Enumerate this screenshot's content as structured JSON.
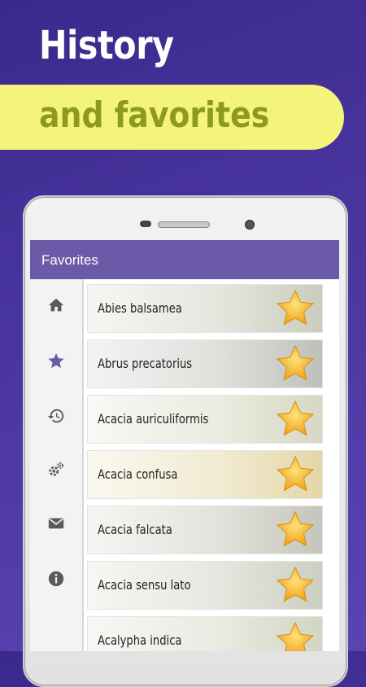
{
  "promo": {
    "title": "History",
    "subtitle": "and favorites"
  },
  "appbar": {
    "title": "Favorites",
    "color": "#6b5aa8"
  },
  "nav_rail": [
    {
      "icon": "home-icon"
    },
    {
      "icon": "star-icon",
      "active": true
    },
    {
      "icon": "history-icon"
    },
    {
      "icon": "settings-icon"
    },
    {
      "icon": "mail-icon"
    },
    {
      "icon": "info-icon"
    }
  ],
  "favorites": [
    {
      "name": "Abies balsamea",
      "bg": "#8a8f6a"
    },
    {
      "name": "Abrus precatorius",
      "bg": "#6f7562"
    },
    {
      "name": "Acacia auriculiformis",
      "bg": "#a7a77a"
    },
    {
      "name": "Acacia confusa",
      "bg": "#c2a63a"
    },
    {
      "name": "Acacia falcata",
      "bg": "#7f8066"
    },
    {
      "name": "Acacia sensu lato",
      "bg": "#8e9470"
    },
    {
      "name": "Acalypha indica",
      "bg": "#97a67a"
    }
  ],
  "colors": {
    "background": "#4a35a0",
    "banner": "#f4f47a",
    "banner_text": "#8e9a1e",
    "star": "#f5b52a",
    "nav_active": "#6b5aa8"
  }
}
